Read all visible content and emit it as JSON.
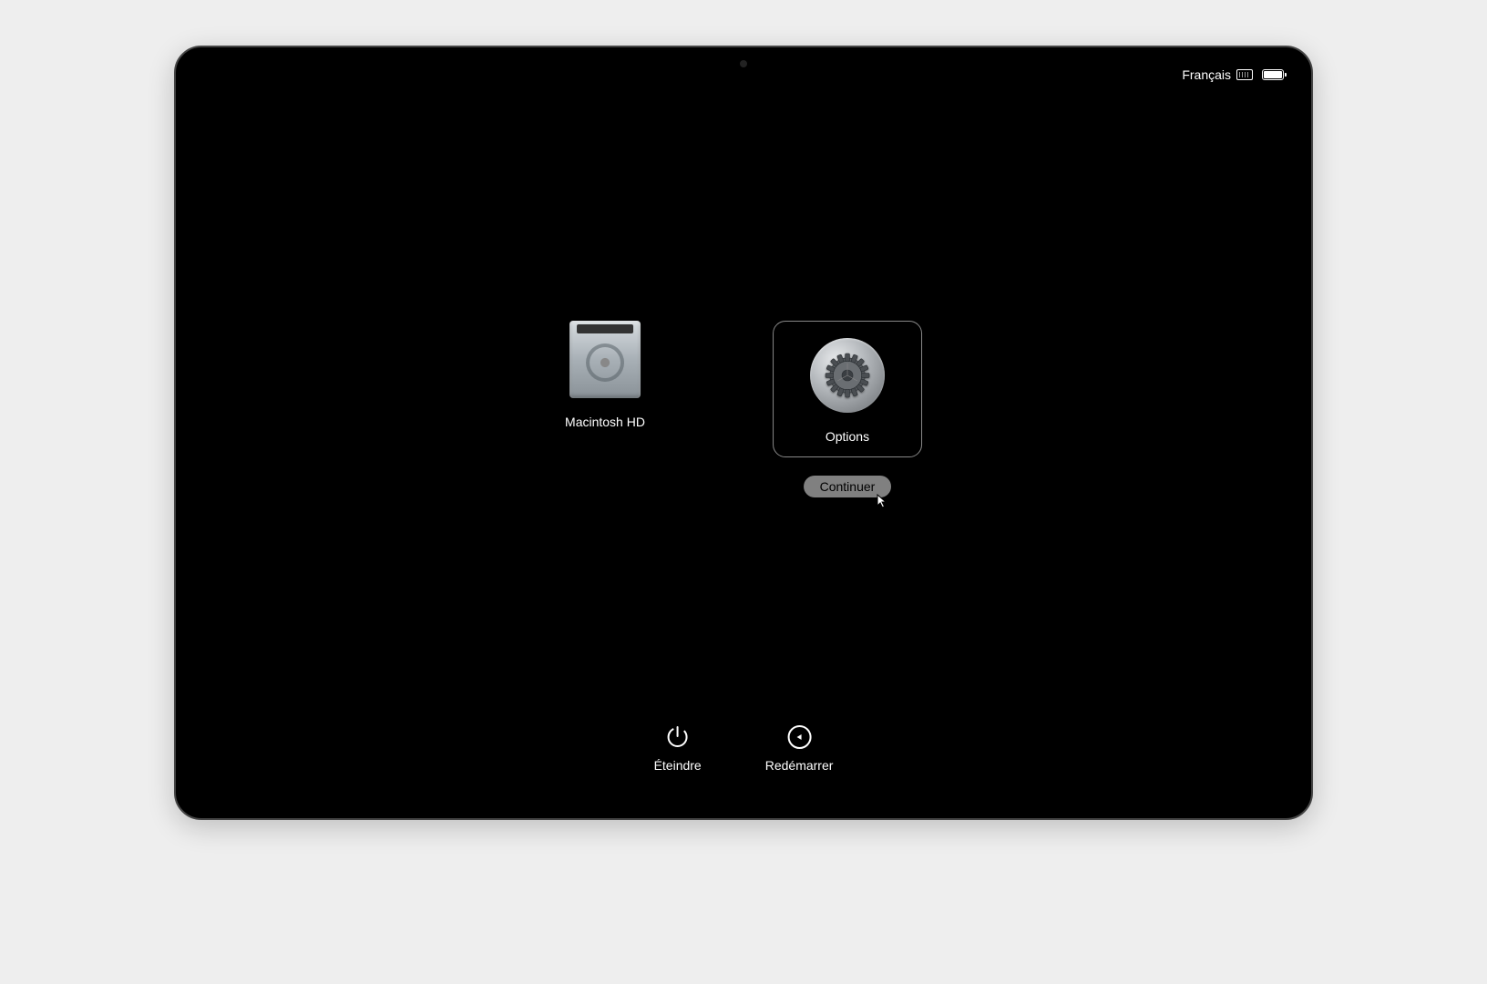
{
  "status": {
    "language": "Français"
  },
  "boot_options": {
    "disk_label": "Macintosh HD",
    "options_label": "Options",
    "continue_label": "Continuer"
  },
  "bottom_actions": {
    "shutdown_label": "Éteindre",
    "restart_label": "Redémarrer"
  }
}
